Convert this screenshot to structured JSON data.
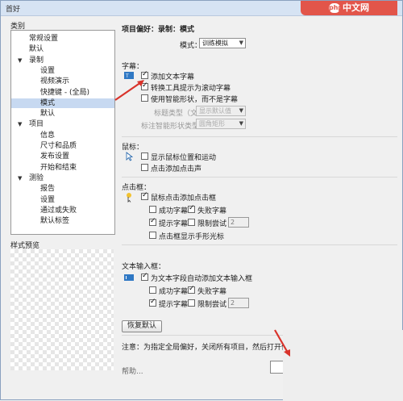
{
  "window": {
    "title": "首好"
  },
  "watermark": {
    "logo_text": "php",
    "text": "中文网"
  },
  "sidebar": {
    "label": "类别",
    "items": [
      {
        "label": "常规设置",
        "indent": 1
      },
      {
        "label": "默认",
        "indent": 1
      },
      {
        "label": "录制",
        "indent": 1,
        "expanded": true
      },
      {
        "label": "设置",
        "indent": 2
      },
      {
        "label": "视频演示",
        "indent": 2
      },
      {
        "label": "快捷键 - (全局)",
        "indent": 2
      },
      {
        "label": "模式",
        "indent": 2,
        "selected": true
      },
      {
        "label": "默认",
        "indent": 2
      },
      {
        "label": "项目",
        "indent": 1,
        "expanded": true
      },
      {
        "label": "信息",
        "indent": 2
      },
      {
        "label": "尺寸和品质",
        "indent": 2
      },
      {
        "label": "发布设置",
        "indent": 2
      },
      {
        "label": "开始和结束",
        "indent": 2
      },
      {
        "label": "测验",
        "indent": 1,
        "expanded": true
      },
      {
        "label": "报告",
        "indent": 2
      },
      {
        "label": "设置",
        "indent": 2
      },
      {
        "label": "通过或失败",
        "indent": 2
      },
      {
        "label": "默认标签",
        "indent": 2
      }
    ],
    "preview_label": "样式预览"
  },
  "panel": {
    "heading": "项目偏好：录制：模式",
    "mode_label": "模式：",
    "mode_value": "训练模拟",
    "captions": {
      "title": "字幕：",
      "add_text_captions": "添加文本字幕",
      "convert_tooltips": "转换工具提示为滚动字幕",
      "use_smart_shapes": "使用智能形状，而不是字幕",
      "caption_type_label": "标题类型（文本）",
      "caption_type_value": "显示默认值",
      "caption_style_label": "标注智能形状类型",
      "caption_style_value": "圆角矩形"
    },
    "mouse": {
      "title": "鼠标：",
      "show_mouse": "显示鼠标位置和运动",
      "add_click_sound": "点击添加点击声"
    },
    "click_box": {
      "title": "点击框：",
      "add_click_box": "鼠标点击添加点击框",
      "success": "成功字幕",
      "failure": "失败字幕",
      "hint": "提示字幕",
      "limit_attempts": "限制尝试",
      "limit_value": "2",
      "hand_cursor": "点击框显示手形光标"
    },
    "text_entry": {
      "title": "文本输入框：",
      "auto_add": "为文本字段自动添加文本输入框",
      "success": "成功字幕",
      "failure": "失败字幕",
      "hint": "提示字幕",
      "limit_attempts": "限制尝试",
      "limit_value": "2"
    },
    "restore_button": "恢复默认",
    "note": "注意：为指定全局偏好，关闭所有项目，然后打开偏",
    "help": "帮助..."
  },
  "colors": {
    "selection": "#c7d9f1",
    "arrow": "#d9332b",
    "watermark": "#e2554a"
  }
}
